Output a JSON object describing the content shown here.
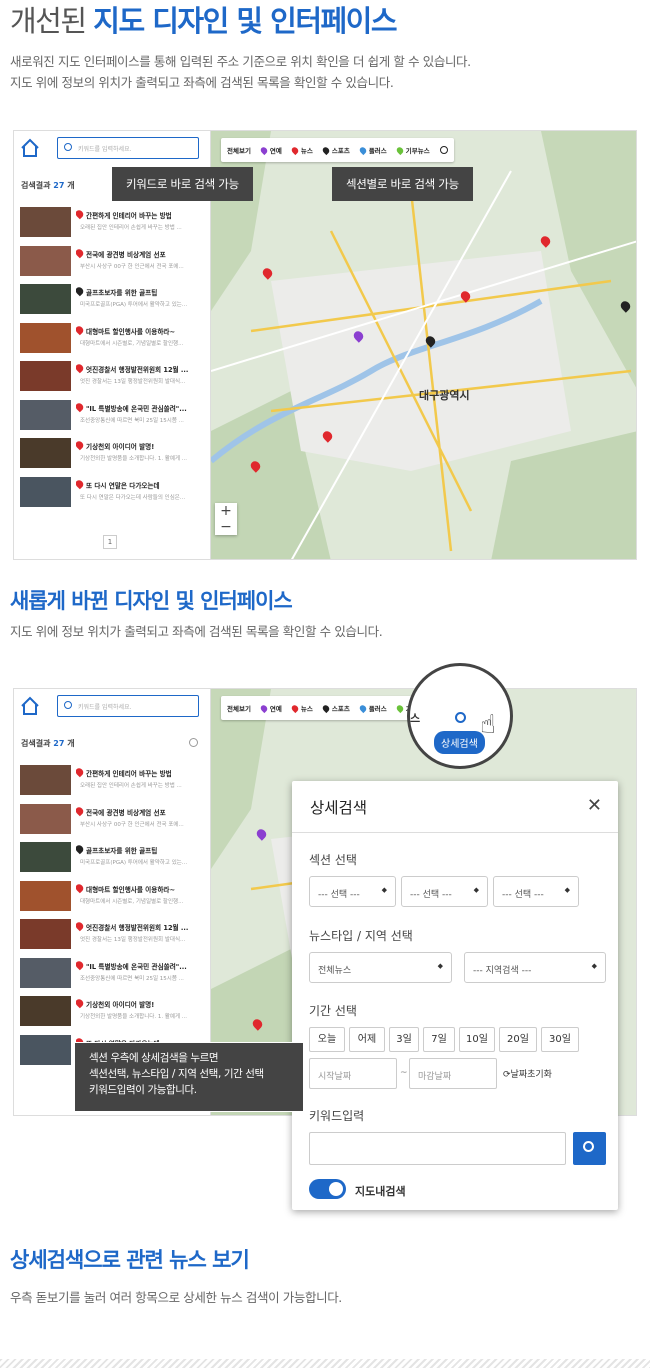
{
  "section1": {
    "title_plain": "개선된 ",
    "title_bold": "지도 디자인 및 인터페이스",
    "desc1": "새로워진 지도 인터페이스를 통해 입력된 주소 기준으로 위치 확인을 더 쉽게 할 수 있습니다.",
    "desc2": "지도 위에 정보의 위치가 출력되고 좌측에 검색된 목록을 확인할 수 있습니다."
  },
  "section2": {
    "title": "새롭게 바뀐 디자인 및 인터페이스",
    "desc": "지도 위에 정보 위치가 출력되고 좌측에 검색된 목록을 확인할 수 있습니다."
  },
  "section3": {
    "title": "상세검색으로 관련 뉴스 보기",
    "desc": "우측 돋보기를 눌러 여러 항목으로 상세한 뉴스 검색이 가능합니다."
  },
  "app": {
    "search_placeholder": "키워드를 입력하세요.",
    "result_label": "검색결과",
    "result_count": "27",
    "result_unit": "개",
    "pager": "1",
    "tabs": [
      {
        "label": "전체보기",
        "color": ""
      },
      {
        "label": "연예",
        "color": "#8b3fd0"
      },
      {
        "label": "뉴스",
        "color": "#e0282d"
      },
      {
        "label": "스포츠",
        "color": "#222222"
      },
      {
        "label": "플러스",
        "color": "#3a8ed8"
      },
      {
        "label": "기부뉴스",
        "color": "#6ac23a"
      }
    ],
    "items": [
      {
        "title": "간편하게 인테리어 바꾸는 방법",
        "desc": "오래된 집안 인테리어 손쉽게 바꾸는 방법 ...",
        "color": "#e0282d"
      },
      {
        "title": "전국에 광견병 비상계엄 선포",
        "desc": "부산시 사상구 00구 한 인근에서 전국 포에...",
        "color": "#e0282d"
      },
      {
        "title": "골프초보자를 위한 골프팁",
        "desc": "미국프로골프(PGA) 투어에서 활약하고 있는...",
        "color": "#222222"
      },
      {
        "title": "대형마트 할인행사를 이용하라~",
        "desc": "대형마트에서 시즌별로, 기념일별로 할인행...",
        "color": "#e0282d"
      },
      {
        "title": "엇진경찰서 행정발전위원회 12월 ...",
        "desc": "엇진 경찰서는 13일 행정발전위원회 발대식...",
        "color": "#e0282d"
      },
      {
        "title": "\"IL 특별방송에 온국민 관심쏠려\"...",
        "desc": "조선중앙통신에 따르면 북미 25일 15시쯤 ...",
        "color": "#e0282d"
      },
      {
        "title": "기상천외 아이디어 발명!",
        "desc": "기상천외한 발명품을 소개합니다. 1. 활예게 ...",
        "color": "#e0282d"
      },
      {
        "title": "또 다시 연말은 다가오는데",
        "desc": "또 다시 연말은 다가오는데 사람들의 인심은...",
        "color": "#e0282d"
      }
    ],
    "map_city": "대구광역시",
    "zoom_in": "+",
    "zoom_out": "−"
  },
  "tooltips": {
    "keyword": "키워드로 바로 검색 가능",
    "section": "섹션별로 바로 검색 가능",
    "detail_line1": "섹션 우측에 상세검색을 누르면",
    "detail_line2": "섹션선택, 뉴스타입 / 지역 선택, 기간 선택",
    "detail_line3": "키워드입력이 가능합니다.",
    "detail_badge": "상세검색",
    "zoom_tab": "스"
  },
  "modal": {
    "title": "상세검색",
    "close": "✕",
    "section_label": "섹션 선택",
    "section_selects": [
      "--- 선택 ---",
      "--- 선택 ---",
      "--- 선택 ---"
    ],
    "type_label": "뉴스타입 / 지역 선택",
    "type_value": "전체뉴스",
    "region_value": "--- 지역검색 ---",
    "period_label": "기간 선택",
    "periods": [
      "오늘",
      "어제",
      "3일",
      "7일",
      "10일",
      "20일",
      "30일"
    ],
    "start_placeholder": "시작날짜",
    "end_placeholder": "마감날짜",
    "tilde": "~",
    "reset": "날짜초기화",
    "keyword_label": "키워드입력",
    "map_search_label": "지도내검색"
  }
}
